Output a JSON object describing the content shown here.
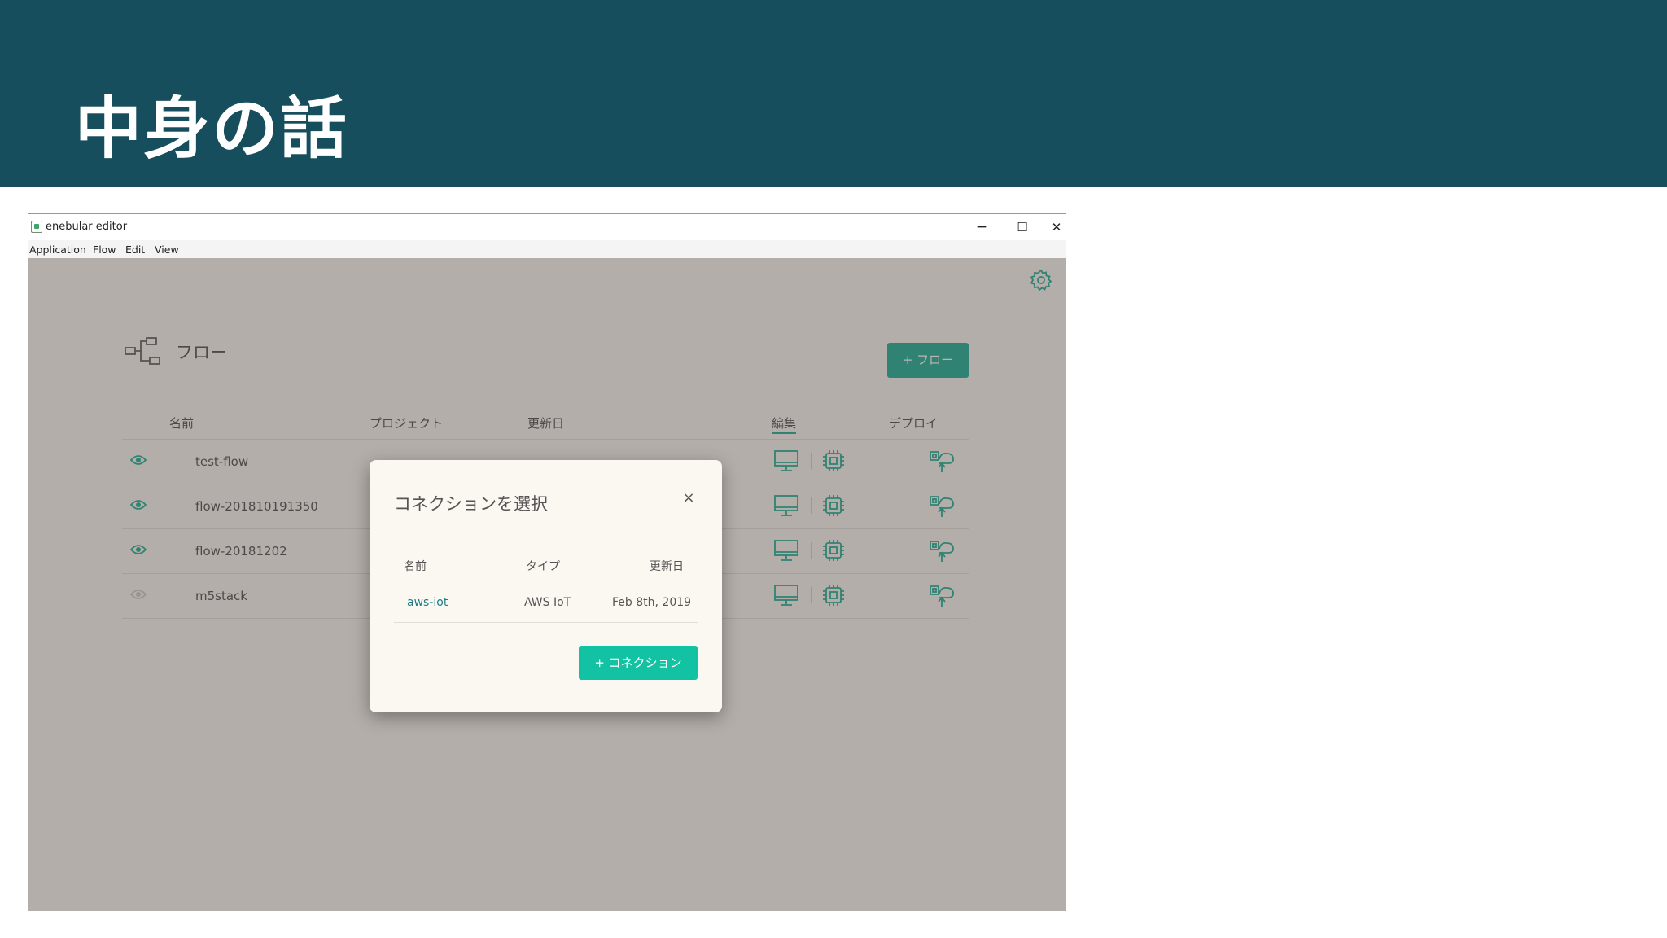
{
  "slide": {
    "title": "中身の話"
  },
  "window": {
    "title": "enebular editor",
    "controls": {
      "minimize": "−",
      "maximize": "☐",
      "close": "✕"
    },
    "menu": [
      "Application",
      "Flow",
      "Edit",
      "View"
    ]
  },
  "page": {
    "heading": "フロー",
    "add_flow_label": "+ フロー",
    "columns": {
      "name": "名前",
      "project": "プロジェクト",
      "updated": "更新日",
      "edit": "編集",
      "deploy": "デプロイ"
    },
    "rows": [
      {
        "name": "test-flow",
        "project": "",
        "updated": "",
        "visible": true
      },
      {
        "name": "flow-201810191350",
        "project": "",
        "updated": "",
        "visible": true
      },
      {
        "name": "flow-20181202",
        "project": "",
        "updated": "",
        "visible": true
      },
      {
        "name": "m5stack",
        "project": "",
        "updated": "",
        "visible": false
      }
    ]
  },
  "dialog": {
    "title": "コネクションを選択",
    "close_label": "×",
    "columns": {
      "name": "名前",
      "type": "タイプ",
      "updated": "更新日"
    },
    "rows": [
      {
        "name": "aws-iot",
        "type": "AWS IoT",
        "updated": "Feb 8th, 2019"
      }
    ],
    "add_connection_label": "+ コネクション"
  },
  "colors": {
    "header_bg": "#164e5d",
    "accent": "#12a58a",
    "accent_light": "#13c2a3"
  }
}
